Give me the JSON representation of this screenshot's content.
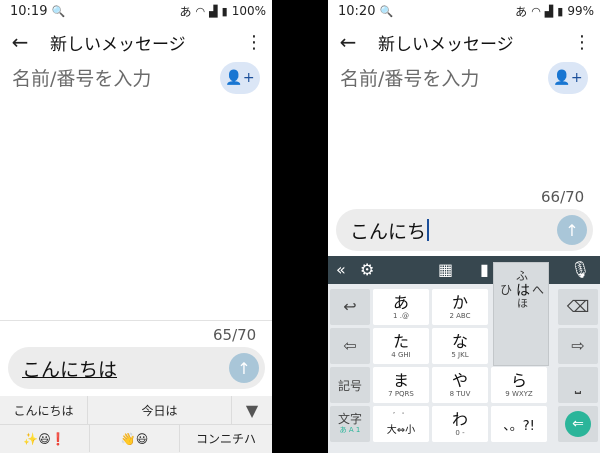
{
  "left": {
    "status": {
      "time": "10:19",
      "input_mode": "あ",
      "battery": "100%"
    },
    "title": "新しいメッセージ",
    "recipient_placeholder": "名前/番号を入力",
    "counter": "65/70",
    "compose_text": "こんにちは",
    "suggestions": {
      "row1": [
        "こんにちは",
        "今日は"
      ],
      "row2": [
        "✨😃❗",
        "👋😃",
        "コンニチハ"
      ]
    }
  },
  "right": {
    "status": {
      "time": "10:20",
      "input_mode": "あ",
      "battery": "99%"
    },
    "title": "新しいメッセージ",
    "recipient_placeholder": "名前/番号を入力",
    "counter": "66/70",
    "compose_text": "こんにち",
    "keyboard": {
      "keys": [
        {
          "main": "あ",
          "sub": "1 .@"
        },
        {
          "main": "か",
          "sub": "2 ABC"
        },
        {
          "main": "た",
          "sub": "4 GHI"
        },
        {
          "main": "な",
          "sub": "5 JKL"
        },
        {
          "main": "ま",
          "sub": "7 PQRS"
        },
        {
          "main": "や",
          "sub": "8 TUV"
        },
        {
          "main": "ら",
          "sub": "9 WXYZ"
        },
        {
          "main": "わ",
          "sub": "0 -"
        },
        {
          "main": "、。?!",
          "sub": ""
        }
      ],
      "left_keys": [
        "記号",
        "文字"
      ],
      "moji_sub": "あ A 1",
      "daishou_top": "゛ ゜",
      "daishou_bottom": "大⇔小",
      "flick_popup": {
        "center": "は",
        "up": "ふ",
        "left": "ひ",
        "right": "へ",
        "down": "ほ"
      }
    }
  },
  "colors": {
    "accent": "#1c4f9a",
    "send": "#a9c6d8",
    "toolbar": "#37474f",
    "enter": "#2bb59a"
  }
}
